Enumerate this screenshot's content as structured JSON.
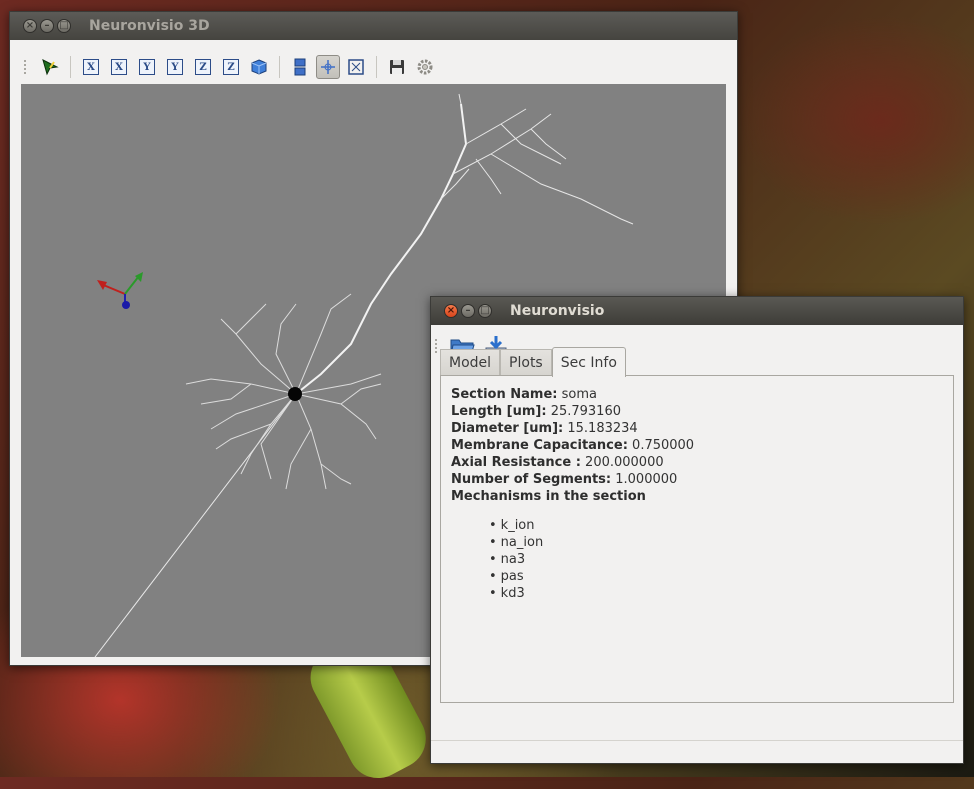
{
  "viewer_window": {
    "title": "Neuronvisio 3D",
    "toolbar": {
      "axis_buttons": [
        "X",
        "X",
        "Y",
        "Y",
        "Z",
        "Z"
      ]
    }
  },
  "main_window": {
    "title": "Neuronvisio",
    "tabs": [
      {
        "label": "Model"
      },
      {
        "label": "Plots"
      },
      {
        "label": "Sec Info",
        "selected": true
      }
    ],
    "sec_info": {
      "section_name_label": "Section Name:",
      "section_name_value": "soma",
      "length_label": "Length [um]:",
      "length_value": "25.793160",
      "diameter_label": "Diameter [um]:",
      "diameter_value": "15.183234",
      "capacitance_label": "Membrane Capacitance:",
      "capacitance_value": "0.750000",
      "resistance_label": "Axial Resistance :",
      "resistance_value": "200.000000",
      "segments_label": "Number of Segments:",
      "segments_value": "1.000000",
      "mechanisms_label": "Mechanisms in the section",
      "mechanisms": [
        "k_ion",
        "na_ion",
        "na3",
        "pas",
        "kd3"
      ]
    }
  }
}
